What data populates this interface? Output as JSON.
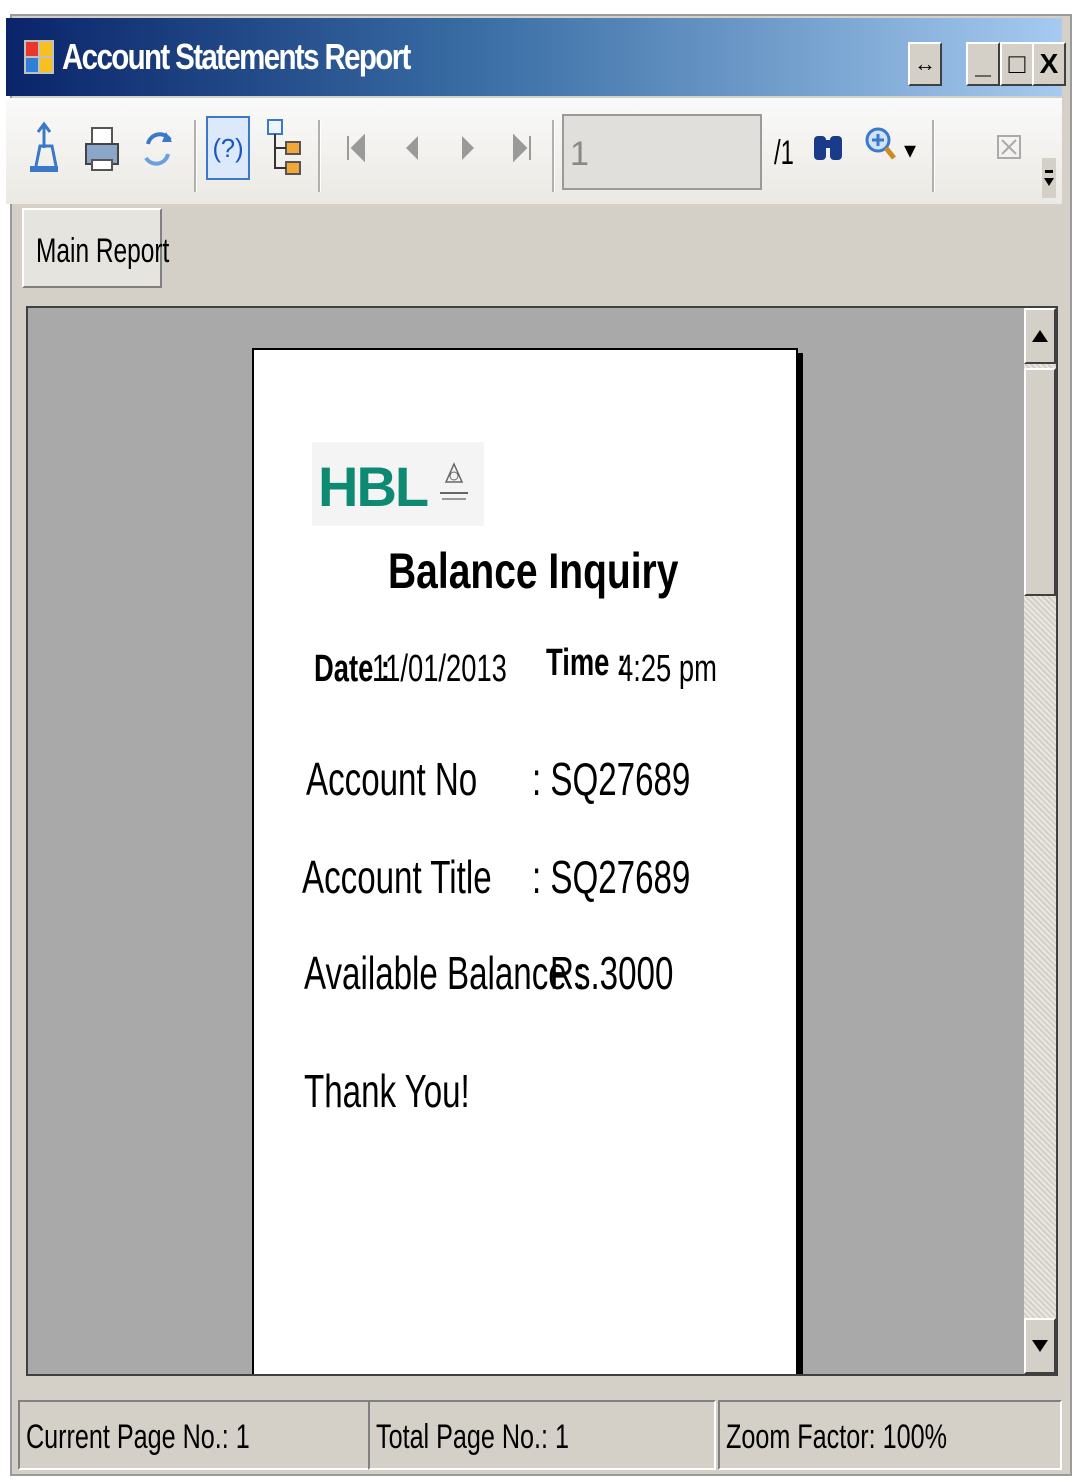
{
  "window": {
    "title": "Account Statements Report",
    "buttons": {
      "restore": "↔",
      "minimize": "_",
      "maximize": "□",
      "close": "X"
    }
  },
  "toolbar": {
    "icons": [
      "export-icon",
      "print-icon",
      "refresh-icon",
      "help-icon",
      "group-tree-icon",
      "first-page-icon",
      "prev-page-icon",
      "next-page-icon",
      "last-page-icon",
      "find-icon",
      "zoom-icon",
      "close-view-icon"
    ],
    "page_value": "1",
    "page_total": "/1",
    "zoom_arrow": "▾"
  },
  "tabs": [
    {
      "label": "Main Report"
    }
  ],
  "report": {
    "logo_text": "HBL",
    "title": "Balance Inquiry",
    "date_label": "Date :",
    "date_value": "11/01/2013",
    "time_label": "Time :",
    "time_value": "4:25 pm",
    "account_no_label": "Account No",
    "account_no_value": ": SQ27689",
    "account_title_label": "Account Title",
    "account_title_value": ": SQ27689",
    "balance_label": "Available Balance :",
    "balance_value": "Rs.3000",
    "closing": "Thank You!"
  },
  "statusbar": {
    "current_page": "Current Page No.: 1",
    "total_page": "Total Page No.: 1",
    "zoom": "Zoom Factor: 100%"
  },
  "colors": {
    "title_start": "#0a246a",
    "title_end": "#a6caf0",
    "logo_green": "#0e8a72",
    "viewer_bg": "#a9a9a9"
  }
}
